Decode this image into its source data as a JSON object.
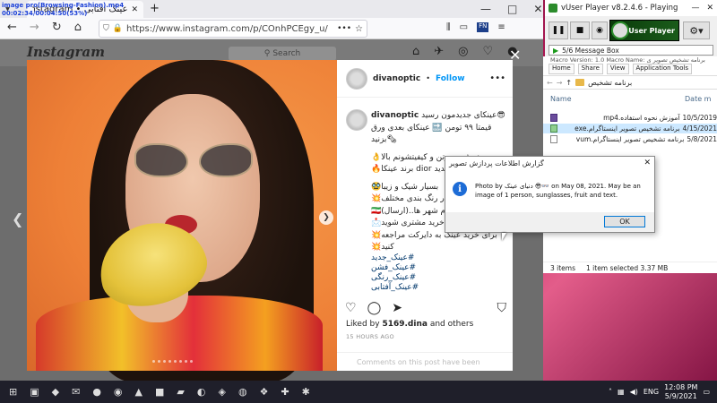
{
  "overlay": {
    "line1": "image pro(Browsing-Fashion).mp4",
    "line2": "00:02:34/00:04:50(53%)"
  },
  "browser": {
    "tab_title": "عینک آفتابی • Instagram",
    "url": "https://www.instagram.com/p/COnhPCEgy_u/",
    "back_icon": "back-arrow-icon",
    "forward_icon": "forward-arrow-icon",
    "reload_icon": "reload-icon",
    "home_icon": "home-icon"
  },
  "instagram": {
    "logo": "Instagram",
    "search_placeholder": "Search",
    "username": "divanoptic",
    "follow": "Follow",
    "dot_sep": "•",
    "caption_user": "divanoptic",
    "caption_lines": [
      "عینکای جدیدمون رسید😎",
      "قیمتا ۹۹ تومن 🔜 عینکای بعدی ورق",
      "بزنید🗞",
      "",
      "👌خوش صورتن و کیفیتشونم بالا",
      "🔥برند عینکا dior جدید",
      "",
      "🥸بسیار شیک و زیبا",
      "💥در رنگ بندی مختلف",
      "🇮🇷تمام شهر ها..(ارسال)",
      "📩باز خرید مشتری شوید",
      "💥برای خرید عینک به دایرکت مراجعه",
      "💥کنید"
    ],
    "tags": [
      "#عینک_جدید",
      "#عینک_فشن",
      "#عینک_رنگی",
      "#عینک_آفتابی"
    ],
    "likes_prefix": "Liked by",
    "likes_user": "‏5169.dina",
    "likes_suffix": "and others",
    "time_ago": "15 HOURS AGO",
    "comment_placeholder": "Comments on this post have been"
  },
  "vuser": {
    "title": "vUser Player v8.2.4.6 - Playing",
    "logo_text": "vUser Player",
    "status_text": "5/6 Message Box"
  },
  "explorer": {
    "macro_version": "Macro Version: 1.0",
    "macro_name": "Macro Name: برنامه تشخیص تصویر ی",
    "ribbon": [
      "Home",
      "Share",
      "View",
      "Application Tools"
    ],
    "breadcrumb": "برنامه تشخیص",
    "col_name": "Name",
    "col_date": "Date m",
    "files": [
      {
        "name": "آموزش نحوه استفاده.mp4",
        "date": "10/5/2019",
        "type": "mp4"
      },
      {
        "name": "برنامه تشخیص تصویر اینستاگرام.exe",
        "date": "4/15/2021",
        "type": "exe"
      },
      {
        "name": "برنامه تشخیص تصویر اینستاگرام.vum",
        "date": "5/8/2021",
        "type": "vum"
      }
    ],
    "items_count": "3 items",
    "selected_info": "1 item selected  3.37 MB"
  },
  "msgbox": {
    "title": "گزارش اطلاعات پردازش تصویر",
    "body": "Photo by دنیای عینک 😎👓 on May 08, 2021. May be an image of 1 person, sunglasses, fruit and text.",
    "ok": "OK"
  },
  "taskbar": {
    "lang": "ENG",
    "time": "12:08 PM",
    "date": "5/9/2021"
  }
}
